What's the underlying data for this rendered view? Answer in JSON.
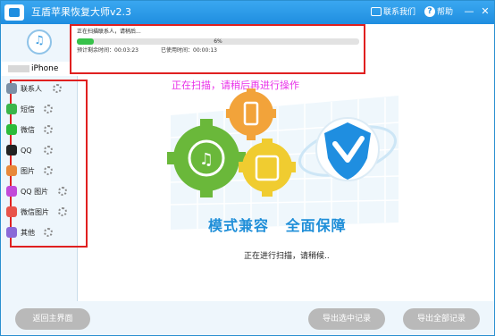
{
  "window": {
    "title": "互盾苹果恢复大师v2.3",
    "contact_label": "联系我们",
    "help_label": "帮助",
    "minimize_symbol": "—",
    "close_symbol": "✕"
  },
  "sidebar": {
    "device_name": "iPhone",
    "items": [
      {
        "label": "联系人",
        "icon": "contacts-icon",
        "color": "#7a8fa6"
      },
      {
        "label": "短信",
        "icon": "sms-icon",
        "color": "#3ab54a"
      },
      {
        "label": "微信",
        "icon": "wechat-icon",
        "color": "#2dbb3a"
      },
      {
        "label": "QQ",
        "icon": "qq-icon",
        "color": "#222222"
      },
      {
        "label": "图片",
        "icon": "photos-icon",
        "color": "#e8883a"
      },
      {
        "label": "QQ 图片",
        "icon": "qq-photos-icon",
        "color": "#c24ad8"
      },
      {
        "label": "微信图片",
        "icon": "wechat-photos-icon",
        "color": "#e8544a"
      },
      {
        "label": "其他",
        "icon": "other-icon",
        "color": "#8a6ad8"
      }
    ]
  },
  "progress": {
    "status": "正在扫描联系人，请稍后...",
    "percent_text": "6%",
    "percent": 6,
    "remaining_label": "预计剩余时间：",
    "remaining_time": "00:03:23",
    "used_label": "已使用时间：",
    "used_time": "00:00:13"
  },
  "main": {
    "scan_warning": "正在扫描，请稍后再进行操作",
    "slogan": "模式兼容 全面保障",
    "scanning_text": "正在进行扫描，请稍候.."
  },
  "footer": {
    "back_label": "返回主界面",
    "export_selected_label": "导出选中记录",
    "export_all_label": "导出全部记录"
  },
  "colors": {
    "accent": "#1f8ee0",
    "highlight_border": "#e02020",
    "progress_fill": "#37c24a",
    "warning_text": "#e830e8"
  }
}
